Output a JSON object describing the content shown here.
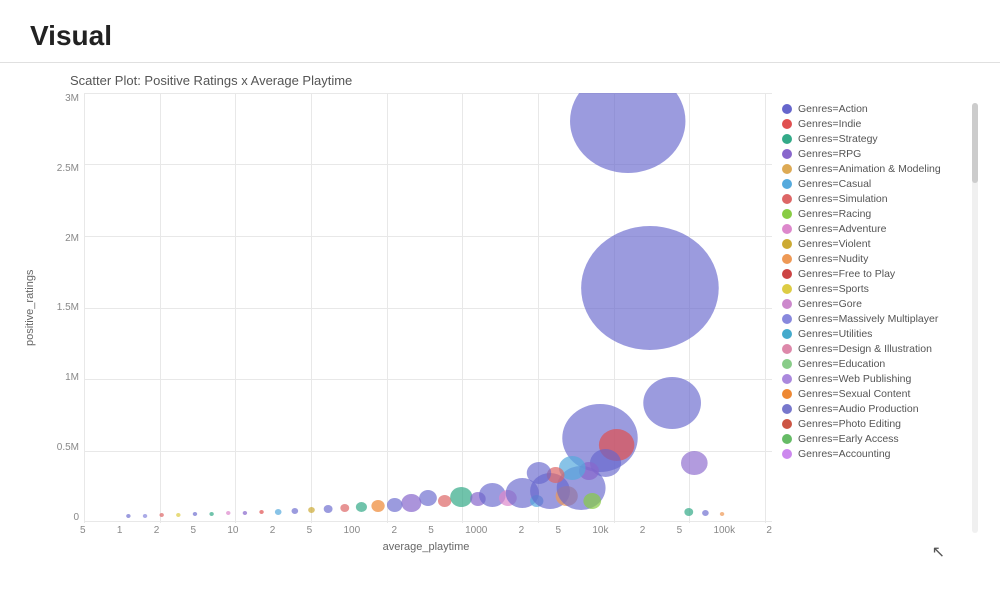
{
  "page": {
    "title": "Visual"
  },
  "chart": {
    "title": "Scatter Plot: Positive Ratings x Average Playtime",
    "x_label": "average_playtime",
    "y_label": "positive_ratings",
    "x_ticks": [
      "5",
      "1",
      "2",
      "5",
      "10",
      "2",
      "5",
      "100",
      "2",
      "5",
      "1000",
      "2",
      "5",
      "10k",
      "2",
      "5",
      "100k",
      "2"
    ],
    "y_ticks": [
      "3M",
      "2.5M",
      "2M",
      "1.5M",
      "1M",
      "0.5M",
      "0"
    ]
  },
  "legend": {
    "items": [
      {
        "label": "Genres=Action",
        "color": "#6666cc"
      },
      {
        "label": "Genres=Indie",
        "color": "#e05050"
      },
      {
        "label": "Genres=Strategy",
        "color": "#33aa88"
      },
      {
        "label": "Genres=RPG",
        "color": "#8866cc"
      },
      {
        "label": "Genres=Animation & Modeling",
        "color": "#ddaa55"
      },
      {
        "label": "Genres=Casual",
        "color": "#55aadd"
      },
      {
        "label": "Genres=Simulation",
        "color": "#dd6666"
      },
      {
        "label": "Genres=Racing",
        "color": "#88cc44"
      },
      {
        "label": "Genres=Adventure",
        "color": "#dd88cc"
      },
      {
        "label": "Genres=Violent",
        "color": "#ccaa33"
      },
      {
        "label": "Genres=Nudity",
        "color": "#ee9955"
      },
      {
        "label": "Genres=Free to Play",
        "color": "#cc4444"
      },
      {
        "label": "Genres=Sports",
        "color": "#ddcc44"
      },
      {
        "label": "Genres=Gore",
        "color": "#cc88cc"
      },
      {
        "label": "Genres=Massively Multiplayer",
        "color": "#8888dd"
      },
      {
        "label": "Genres=Utilities",
        "color": "#44aacc"
      },
      {
        "label": "Genres=Design & Illustration",
        "color": "#dd88aa"
      },
      {
        "label": "Genres=Education",
        "color": "#88cc88"
      },
      {
        "label": "Genres=Web Publishing",
        "color": "#aa88dd"
      },
      {
        "label": "Genres=Sexual Content",
        "color": "#ee8833"
      },
      {
        "label": "Genres=Audio Production",
        "color": "#7777cc"
      },
      {
        "label": "Genres=Photo Editing",
        "color": "#cc5544"
      },
      {
        "label": "Genres=Early Access",
        "color": "#66bb66"
      },
      {
        "label": "Genres=Accounting",
        "color": "#cc88ee"
      }
    ]
  }
}
